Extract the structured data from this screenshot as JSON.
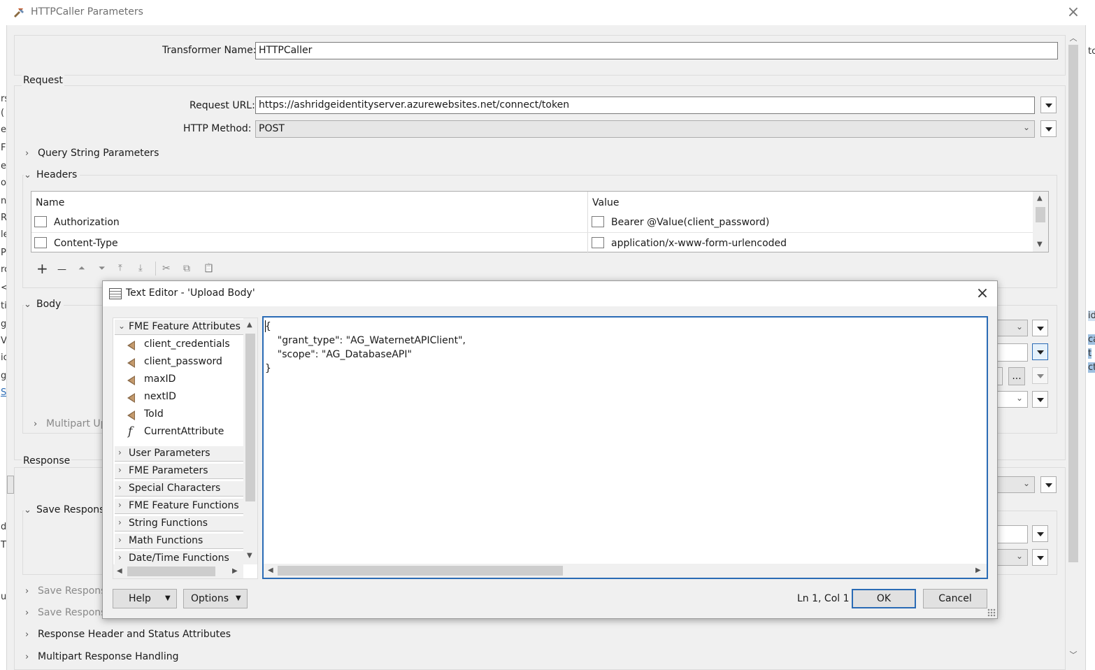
{
  "window": {
    "title": "HTTPCaller Parameters"
  },
  "transformer": {
    "label": "Transformer Name:",
    "value": "HTTPCaller"
  },
  "request": {
    "section": "Request",
    "url_label": "Request URL:",
    "url": "https://ashridgeidentityserver.azurewebsites.net/connect/token",
    "method_label": "HTTP Method:",
    "method": "POST",
    "query_string": "Query String Parameters",
    "headers": "Headers",
    "headers_table": {
      "name_col": "Name",
      "value_col": "Value",
      "rows": [
        {
          "name": "Authorization",
          "value": "Bearer @Value(client_password)"
        },
        {
          "name": "Content-Type",
          "value": "application/x-www-form-urlencoded"
        }
      ]
    },
    "toolbar": {
      "add": "+",
      "remove": "—",
      "up": "⏶",
      "down": "⏷",
      "top": "⤒",
      "bottom": "⤓",
      "cut": "✂",
      "copy": "⧉",
      "paste": "📋"
    }
  },
  "body_section": {
    "label": "Body",
    "multipart": "Multipart Up"
  },
  "response": {
    "section": "Response",
    "save_response_1": "Save Respons",
    "save_response_2": "Save Respons",
    "save_response_3": "Save Respons",
    "header_status": "Response Header and Status Attributes",
    "multipart": "Multipart Response Handling"
  },
  "left_strip": [
    "rs",
    "(",
    "e",
    "F",
    "ec",
    "o",
    "nc",
    "R",
    "le",
    "P",
    "rc",
    "<",
    "ti",
    "g",
    "V",
    "ic",
    "g",
    "S",
    "d",
    "T",
    "ul"
  ],
  "right_strip": [
    "tc",
    "id",
    "ca",
    "t",
    "ctc"
  ],
  "dialog": {
    "title": "Text Editor - 'Upload Body'",
    "tree": {
      "attributes_category": "FME Feature Attributes",
      "attributes": [
        "client_credentials",
        "client_password",
        "maxID",
        "nextID",
        "ToId"
      ],
      "function_item": "CurrentAttribute",
      "categories": [
        "User Parameters",
        "FME Parameters",
        "Special Characters",
        "FME Feature Functions",
        "String Functions",
        "Math Functions",
        "Date/Time Functions"
      ]
    },
    "editor_text": "{\n    \"grant_type\": \"AG_WaternetAPIClient\",\n    \"scope\": \"AG_DatabaseAPI\"\n}",
    "help_label": "Help",
    "options_label": "Options",
    "position": "Ln 1, Col 1",
    "ok_label": "OK",
    "cancel_label": "Cancel"
  },
  "icons": {
    "close": "×",
    "expand": "›",
    "collapse": "⌄",
    "ellipsis": "..."
  },
  "colors": {
    "focus": "#2a6bb5",
    "attribute_icon": "#8b6b4a"
  }
}
